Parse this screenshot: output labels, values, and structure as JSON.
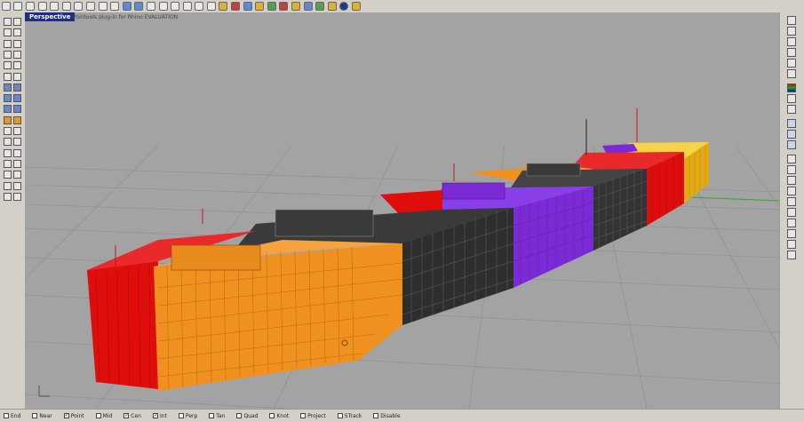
{
  "viewport": {
    "title": "Perspective",
    "note": "Pointools plug-in for Rhino EVALUATION"
  },
  "toolbar_top": {
    "icons": [
      "new-file",
      "open-file",
      "save-file",
      "print",
      "open-template",
      "cut",
      "copy",
      "paste",
      "undo",
      "redo",
      "pan",
      "rotate-view",
      "zoom-dynamic",
      "zoom-window",
      "zoom-extents",
      "zoom-selected",
      "zoom-all",
      "select-all",
      "properties",
      "render-preview",
      "shade",
      "light",
      "layer",
      "color-wheel",
      "material",
      "environment",
      "texture",
      "sun",
      "render",
      "help"
    ]
  },
  "status_bar": {
    "snaps": [
      {
        "label": "End",
        "checked": false
      },
      {
        "label": "Near",
        "checked": false
      },
      {
        "label": "Point",
        "checked": true
      },
      {
        "label": "Mid",
        "checked": false
      },
      {
        "label": "Cen",
        "checked": true
      },
      {
        "label": "Int",
        "checked": true
      },
      {
        "label": "Perp",
        "checked": false
      },
      {
        "label": "Tan",
        "checked": false
      },
      {
        "label": "Quad",
        "checked": false
      },
      {
        "label": "Knot",
        "checked": false
      },
      {
        "label": "Project",
        "checked": false
      },
      {
        "label": "STrack",
        "checked": false
      },
      {
        "label": "Disable",
        "checked": false
      }
    ]
  },
  "scene": {
    "model_colors": {
      "red": "#e00d0d",
      "orange": "#f0901f",
      "black": "#2a2a2a",
      "purple": "#7a2bd6",
      "yellow": "#f4c21c"
    },
    "background": "#a3a3a3",
    "grid_color": "#8a8a8a"
  }
}
